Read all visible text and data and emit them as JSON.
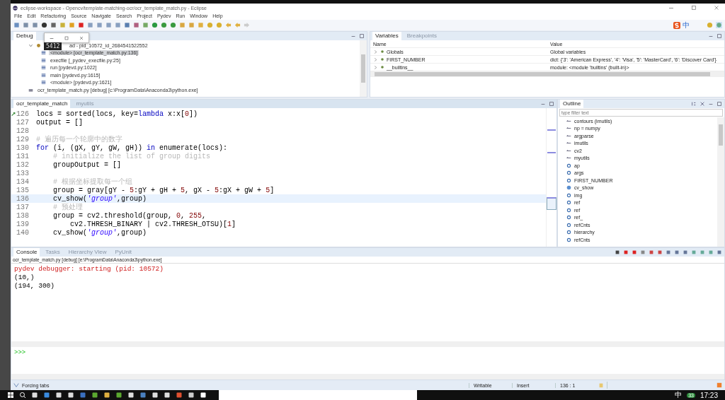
{
  "window": {
    "title": "eclipse-workspace - Opencv/template-matching-ocr/ocr_template_match.py - Eclipse"
  },
  "menu": [
    "File",
    "Edit",
    "Refactoring",
    "Source",
    "Navigate",
    "Search",
    "Project",
    "Pydev",
    "Run",
    "Window",
    "Help"
  ],
  "ime": {
    "label": "中"
  },
  "debug": {
    "tab": "Debug",
    "tooltip": "5412",
    "thread": {
      "label": "ad - pid_10572_id_2684541522552",
      "expanded": true,
      "frames": [
        {
          "label": "<module> [ocr_template_match.py:136]",
          "selected": true
        },
        {
          "label": "execfile [_pydev_execfile.py:25]",
          "selected": false
        },
        {
          "label": "run [pydevd.py:1022]",
          "selected": false
        },
        {
          "label": "main [pydevd.py:1615]",
          "selected": false
        },
        {
          "label": "<module> [pydevd.py:1621]",
          "selected": false
        }
      ]
    },
    "process": "ocr_template_match.py [debug] [c:\\ProgramData\\Anaconda3\\python.exe]"
  },
  "variables": {
    "tabs": [
      {
        "label": "Variables",
        "selected": true
      },
      {
        "label": "Breakpoints",
        "selected": false
      }
    ],
    "columns": [
      "Name",
      "Value"
    ],
    "rows": [
      {
        "name": "Globals",
        "value": "Global variables"
      },
      {
        "name": "FIRST_NUMBER",
        "value": "dict: {'3': 'American Express', '4': 'Visa', '5': 'MasterCard', '6': 'Discover Card'}"
      },
      {
        "name": "__builtins__",
        "value": "module: <module 'builtins' (built-in)>"
      }
    ]
  },
  "editor": {
    "tabs": [
      {
        "label": "ocr_template_match",
        "selected": true
      },
      {
        "label": "myutils",
        "selected": false
      }
    ],
    "lines": [
      {
        "num": "126",
        "current": false,
        "breakpoint": true,
        "parts": [
          {
            "kind": "plain",
            "text": "locs = sorted(locs, key="
          },
          {
            "kind": "keyword",
            "text": "lambda"
          },
          {
            "kind": "plain",
            "text": " x:x["
          },
          {
            "kind": "number",
            "text": "0"
          },
          {
            "kind": "plain",
            "text": "])"
          }
        ]
      },
      {
        "num": "127",
        "current": false,
        "breakpoint": false,
        "parts": [
          {
            "kind": "plain",
            "text": "output = []"
          }
        ]
      },
      {
        "num": "128",
        "current": false,
        "breakpoint": false
      },
      {
        "num": "129",
        "current": false,
        "breakpoint": false,
        "parts": [
          {
            "kind": "comment",
            "text": "# 遍历每一个轮廓中的数字"
          }
        ]
      },
      {
        "num": "130",
        "current": false,
        "breakpoint": false,
        "parts": [
          {
            "kind": "keyword",
            "text": "for"
          },
          {
            "kind": "plain",
            "text": " (i, (gX, gY, gW, gH)) "
          },
          {
            "kind": "keyword",
            "text": "in"
          },
          {
            "kind": "plain",
            "text": " enumerate(locs):"
          }
        ]
      },
      {
        "num": "131",
        "current": false,
        "breakpoint": false,
        "parts": [
          {
            "kind": "comment",
            "text": "    # initialize the list of group digits"
          }
        ]
      },
      {
        "num": "132",
        "current": false,
        "breakpoint": false,
        "parts": [
          {
            "kind": "plain",
            "text": "    groupOutput = []"
          }
        ]
      },
      {
        "num": "133",
        "current": false,
        "breakpoint": false
      },
      {
        "num": "134",
        "current": false,
        "breakpoint": false,
        "parts": [
          {
            "kind": "comment",
            "text": "    # 根据坐标提取每一个组"
          }
        ]
      },
      {
        "num": "135",
        "current": false,
        "breakpoint": false,
        "parts": [
          {
            "kind": "plain",
            "text": "    group = gray[gY - "
          },
          {
            "kind": "number",
            "text": "5"
          },
          {
            "kind": "plain",
            "text": ":gY + gH + "
          },
          {
            "kind": "number",
            "text": "5"
          },
          {
            "kind": "plain",
            "text": ", gX - "
          },
          {
            "kind": "number",
            "text": "5"
          },
          {
            "kind": "plain",
            "text": ":gX + gW + "
          },
          {
            "kind": "number",
            "text": "5"
          },
          {
            "kind": "plain",
            "text": "]"
          }
        ]
      },
      {
        "num": "136",
        "current": true,
        "breakpoint": false,
        "parts": [
          {
            "kind": "plain",
            "text": "    cv_show("
          },
          {
            "kind": "string",
            "text": "'group'"
          },
          {
            "kind": "plain",
            "text": ",group)"
          }
        ]
      },
      {
        "num": "137",
        "current": false,
        "breakpoint": false,
        "parts": [
          {
            "kind": "comment",
            "text": "    # 预处理"
          }
        ]
      },
      {
        "num": "138",
        "current": false,
        "breakpoint": false,
        "parts": [
          {
            "kind": "plain",
            "text": "    group = cv2.threshold(group, "
          },
          {
            "kind": "number",
            "text": "0"
          },
          {
            "kind": "plain",
            "text": ", "
          },
          {
            "kind": "number",
            "text": "255"
          },
          {
            "kind": "plain",
            "text": ","
          }
        ]
      },
      {
        "num": "139",
        "current": false,
        "breakpoint": false,
        "parts": [
          {
            "kind": "plain",
            "text": "        cv2.THRESH_BINARY | cv2.THRESH_OTSU)["
          },
          {
            "kind": "number",
            "text": "1"
          },
          {
            "kind": "plain",
            "text": "]"
          }
        ]
      },
      {
        "num": "140",
        "current": false,
        "breakpoint": false,
        "parts": [
          {
            "kind": "plain",
            "text": "    cv_show("
          },
          {
            "kind": "string",
            "text": "'group'"
          },
          {
            "kind": "plain",
            "text": ",group)"
          }
        ]
      }
    ]
  },
  "outline": {
    "tab": "Outline",
    "filter": {
      "placeholder": "type filter text"
    },
    "items": [
      {
        "kind": "import",
        "label": "contours (imutils)"
      },
      {
        "kind": "import",
        "label": "np = numpy"
      },
      {
        "kind": "import",
        "label": "argparse"
      },
      {
        "kind": "import",
        "label": "imutils"
      },
      {
        "kind": "import",
        "label": "cv2"
      },
      {
        "kind": "import",
        "label": "myutils"
      },
      {
        "kind": "var",
        "label": "ap"
      },
      {
        "kind": "var",
        "label": "args"
      },
      {
        "kind": "var",
        "label": "FIRST_NUMBER"
      },
      {
        "kind": "func",
        "label": "cv_show"
      },
      {
        "kind": "var",
        "label": "img"
      },
      {
        "kind": "var",
        "label": "ref"
      },
      {
        "kind": "var",
        "label": "ref"
      },
      {
        "kind": "var",
        "label": "ref_"
      },
      {
        "kind": "var",
        "label": "refCnts"
      },
      {
        "kind": "var",
        "label": "hierarchy"
      },
      {
        "kind": "var",
        "label": "refCnts"
      }
    ]
  },
  "console": {
    "tabs": [
      {
        "label": "Console",
        "selected": true
      },
      {
        "label": "Tasks",
        "selected": false
      },
      {
        "label": "Hierarchy View",
        "selected": false
      },
      {
        "label": "PyUnit",
        "selected": false
      }
    ],
    "path": "ocr_template_match.py [debug] [e:\\ProgramData\\Anaconda3\\python.exe]",
    "output": [
      {
        "kind": "err",
        "text": "pydev debugger: starting (pid: 10572)"
      },
      {
        "kind": "out",
        "text": "(10,)"
      },
      {
        "kind": "out",
        "text": "(194, 300)"
      }
    ],
    "prompt": ">>>"
  },
  "status_bar": {
    "message": "Forcing tabs",
    "fields": [
      "Writable",
      "Insert",
      "136 : 1"
    ]
  },
  "taskbar": {
    "ime": "中",
    "badge": "33",
    "clock": "17:23"
  }
}
